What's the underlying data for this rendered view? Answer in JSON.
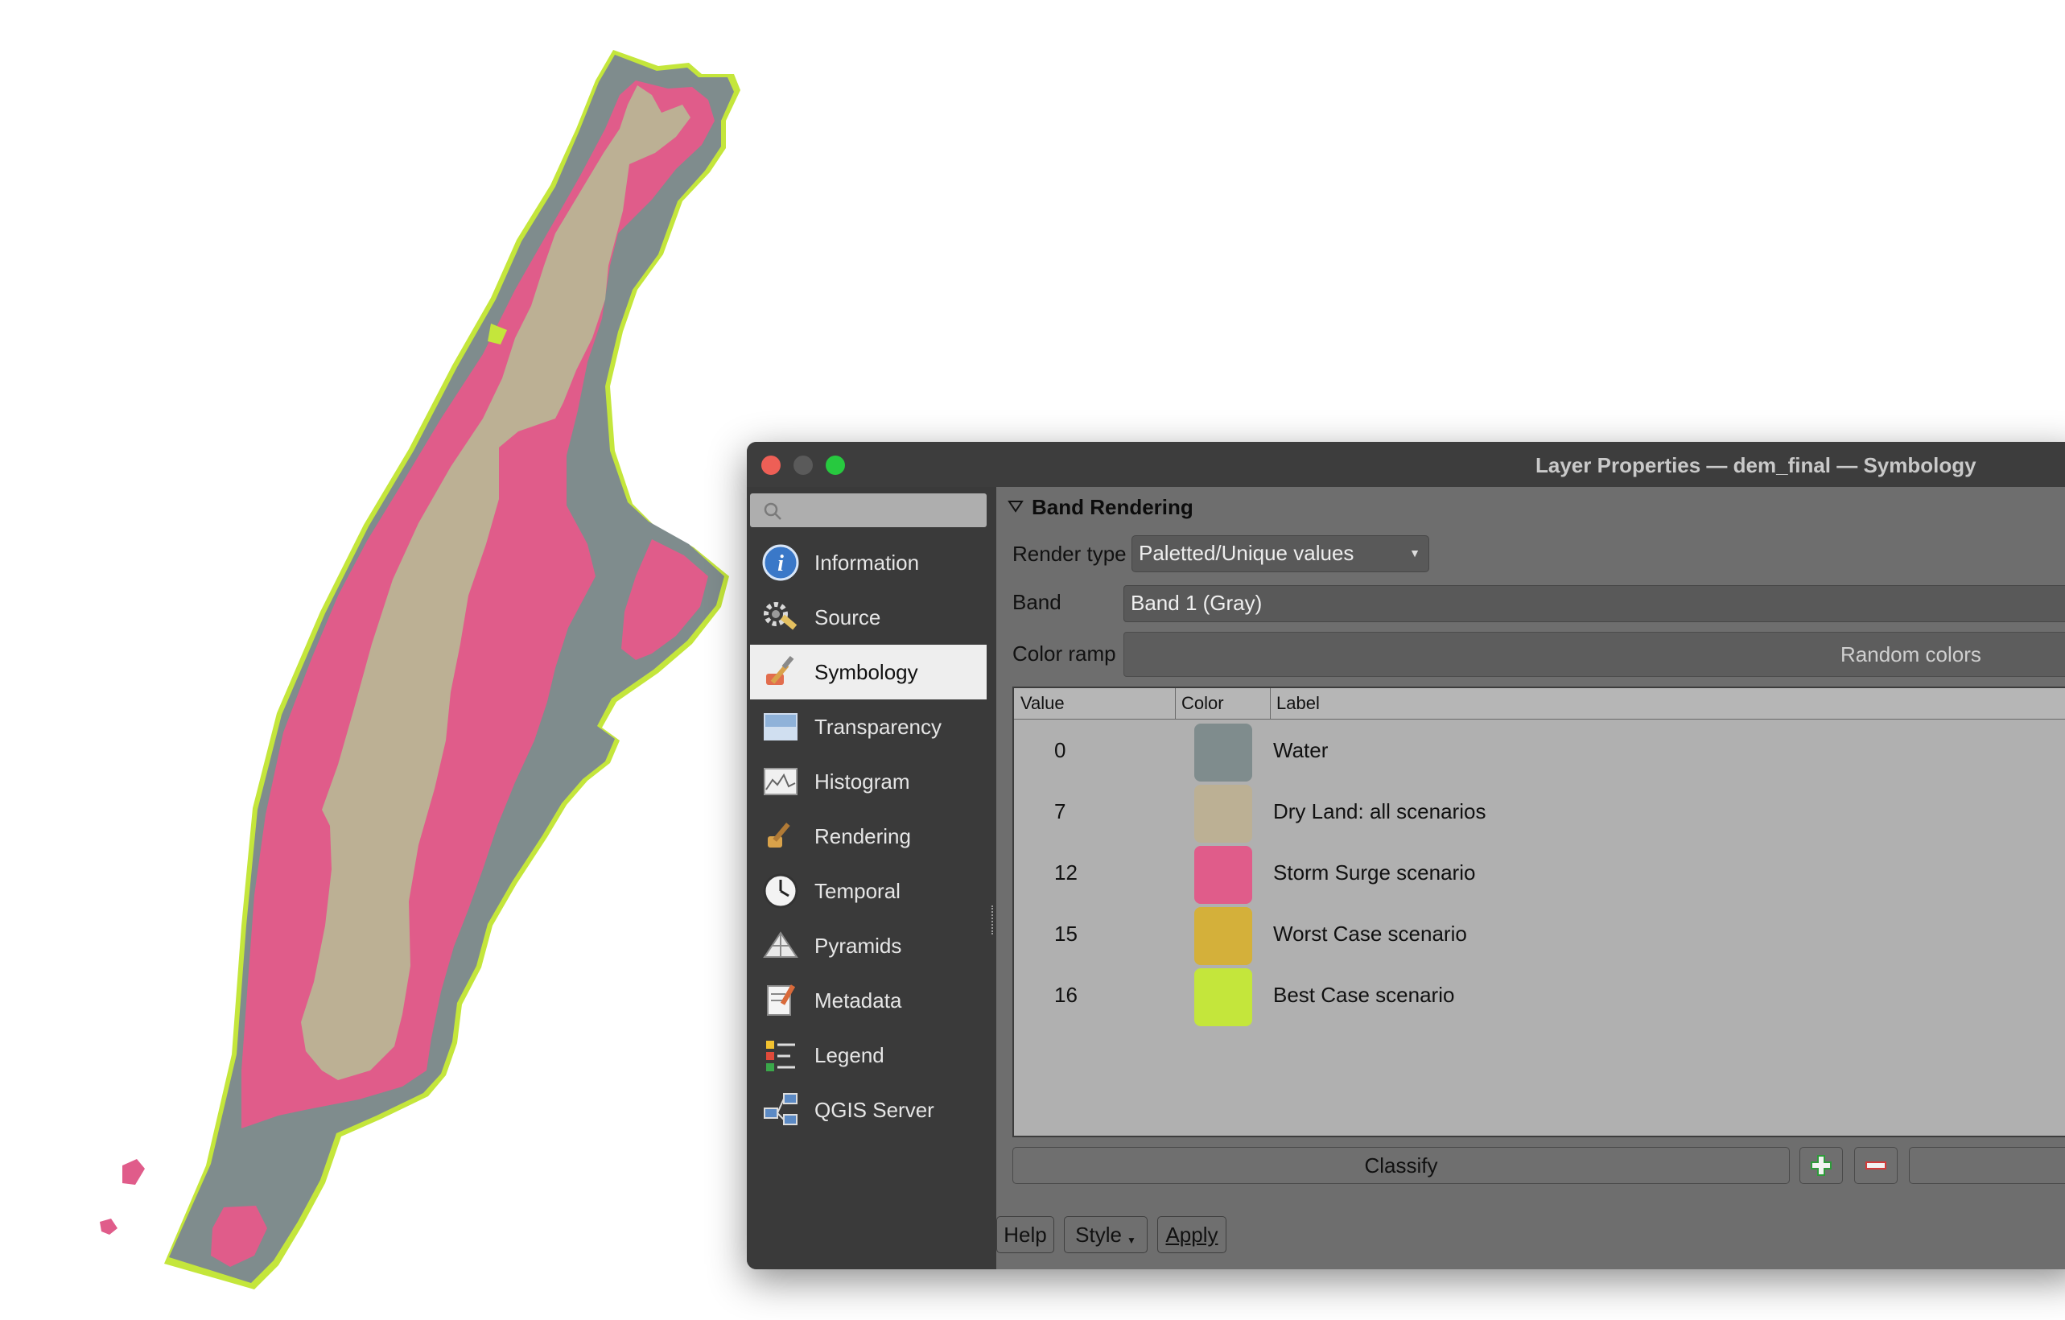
{
  "map": {
    "colors": {
      "water": "#7f8c8d",
      "dry_land": "#bcb094",
      "storm_surge": "#e05c8a",
      "worst_case": "#d4b03a",
      "best_case": "#c4e63b"
    }
  },
  "window": {
    "title": "Layer Properties — dem_final — Symbology",
    "traffic_lights": [
      "close",
      "minimize",
      "zoom"
    ]
  },
  "sidebar": {
    "search_placeholder": "",
    "items": [
      {
        "label": "Information",
        "icon": "information-icon",
        "active": false
      },
      {
        "label": "Source",
        "icon": "source-icon",
        "active": false
      },
      {
        "label": "Symbology",
        "icon": "symbology-icon",
        "active": true
      },
      {
        "label": "Transparency",
        "icon": "transparency-icon",
        "active": false
      },
      {
        "label": "Histogram",
        "icon": "histogram-icon",
        "active": false
      },
      {
        "label": "Rendering",
        "icon": "rendering-icon",
        "active": false
      },
      {
        "label": "Temporal",
        "icon": "temporal-icon",
        "active": false
      },
      {
        "label": "Pyramids",
        "icon": "pyramids-icon",
        "active": false
      },
      {
        "label": "Metadata",
        "icon": "metadata-icon",
        "active": false
      },
      {
        "label": "Legend",
        "icon": "legend-icon",
        "active": false
      },
      {
        "label": "QGIS Server",
        "icon": "qgis-server-icon",
        "active": false
      }
    ]
  },
  "band_rendering": {
    "section_title": "Band Rendering",
    "render_type_label": "Render type",
    "render_type_value": "Paletted/Unique values",
    "band_label": "Band",
    "band_value": "Band 1 (Gray)",
    "color_ramp_label": "Color ramp",
    "color_ramp_value": "Random colors"
  },
  "palette_table": {
    "headers": {
      "value": "Value",
      "color": "Color",
      "label": "Label"
    },
    "rows": [
      {
        "value": "0",
        "color": "#7f8c8d",
        "label": "Water"
      },
      {
        "value": "7",
        "color": "#bcb094",
        "label": "Dry Land: all scenarios"
      },
      {
        "value": "12",
        "color": "#e05c8a",
        "label": "Storm Surge scenario"
      },
      {
        "value": "15",
        "color": "#d4b03a",
        "label": "Worst Case scenario"
      },
      {
        "value": "16",
        "color": "#c4e63b",
        "label": "Best Case scenario"
      }
    ]
  },
  "actions": {
    "classify": "Classify",
    "add": "+",
    "remove": "−"
  },
  "footer": {
    "help": "Help",
    "style": "Style",
    "apply": "Apply"
  }
}
